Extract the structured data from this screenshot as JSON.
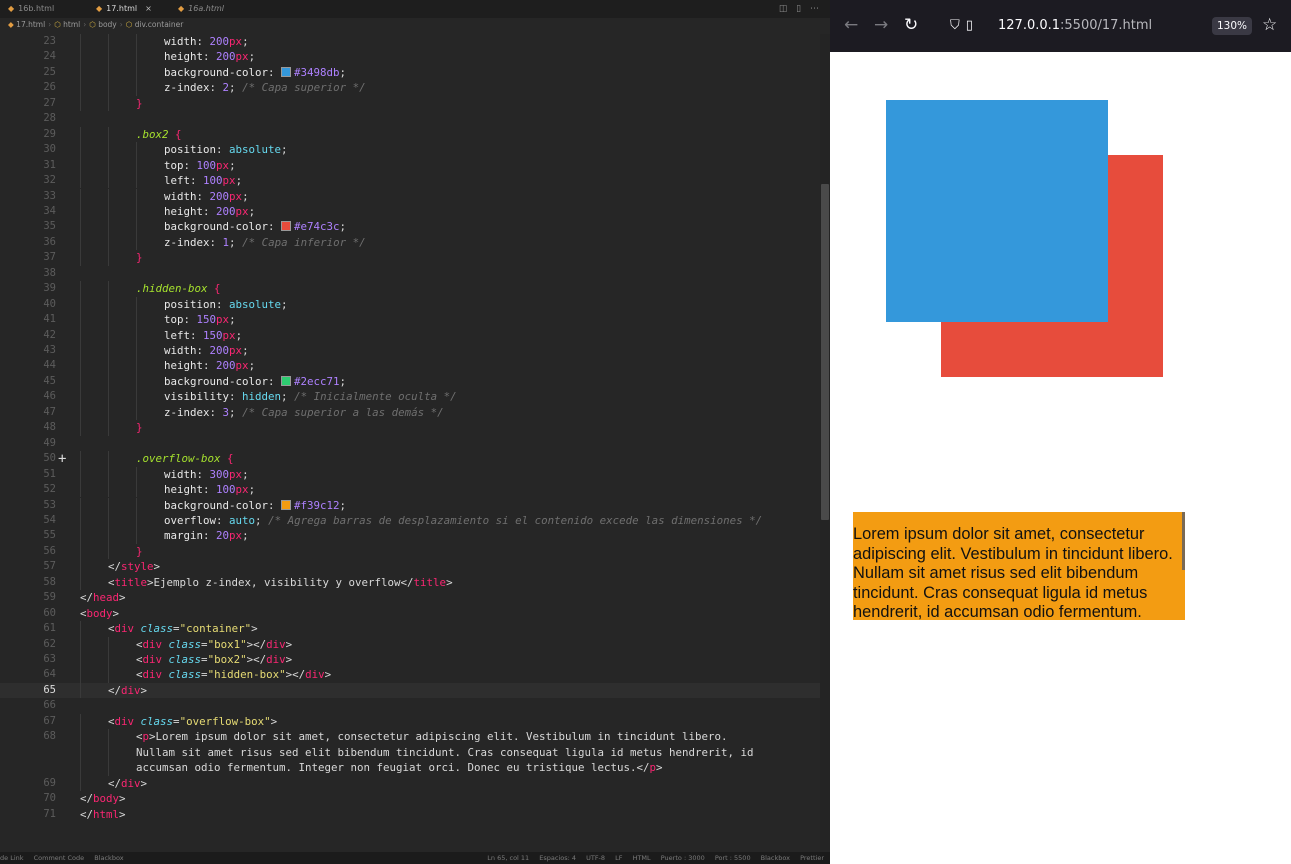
{
  "editor": {
    "tabs": [
      {
        "label": "16b.html",
        "state": "normal"
      },
      {
        "label": "17.html",
        "state": "active"
      },
      {
        "label": "16a.html",
        "state": "preview"
      }
    ],
    "tab_close_glyph": "×",
    "breadcrumb": [
      "17.html",
      "html",
      "body",
      "div.container"
    ],
    "current_line": 65,
    "lines": [
      {
        "n": "23",
        "segs": [
          [
            "prop",
            "width"
          ],
          [
            "pun",
            ": "
          ],
          [
            "num",
            "200"
          ],
          [
            "unit",
            "px"
          ],
          [
            "pun",
            ";"
          ]
        ],
        "indent": 3
      },
      {
        "n": "24",
        "segs": [
          [
            "prop",
            "height"
          ],
          [
            "pun",
            ": "
          ],
          [
            "num",
            "200"
          ],
          [
            "unit",
            "px"
          ],
          [
            "pun",
            ";"
          ]
        ],
        "indent": 3
      },
      {
        "n": "25",
        "segs": [
          [
            "prop",
            "background-color"
          ],
          [
            "pun",
            ": "
          ],
          [
            "swatch",
            "#3498db"
          ],
          [
            "num",
            "#3498db"
          ],
          [
            "pun",
            ";"
          ]
        ],
        "indent": 3
      },
      {
        "n": "26",
        "segs": [
          [
            "prop",
            "z-index"
          ],
          [
            "pun",
            ": "
          ],
          [
            "num",
            "2"
          ],
          [
            "pun",
            "; "
          ],
          [
            "cmt",
            "/* Capa superior */"
          ]
        ],
        "indent": 3
      },
      {
        "n": "27",
        "segs": [
          [
            "brc",
            "}"
          ]
        ],
        "indent": 2
      },
      {
        "n": "28",
        "segs": [],
        "indent": 0
      },
      {
        "n": "29",
        "segs": [
          [
            "sel",
            ".box2 "
          ],
          [
            "brc",
            "{"
          ]
        ],
        "indent": 2
      },
      {
        "n": "30",
        "segs": [
          [
            "prop",
            "position"
          ],
          [
            "pun",
            ": "
          ],
          [
            "val",
            "absolute"
          ],
          [
            "pun",
            ";"
          ]
        ],
        "indent": 3
      },
      {
        "n": "31",
        "segs": [
          [
            "prop",
            "top"
          ],
          [
            "pun",
            ": "
          ],
          [
            "num",
            "100"
          ],
          [
            "unit",
            "px"
          ],
          [
            "pun",
            ";"
          ]
        ],
        "indent": 3
      },
      {
        "n": "32",
        "segs": [
          [
            "prop",
            "left"
          ],
          [
            "pun",
            ": "
          ],
          [
            "num",
            "100"
          ],
          [
            "unit",
            "px"
          ],
          [
            "pun",
            ";"
          ]
        ],
        "indent": 3
      },
      {
        "n": "33",
        "segs": [
          [
            "prop",
            "width"
          ],
          [
            "pun",
            ": "
          ],
          [
            "num",
            "200"
          ],
          [
            "unit",
            "px"
          ],
          [
            "pun",
            ";"
          ]
        ],
        "indent": 3
      },
      {
        "n": "34",
        "segs": [
          [
            "prop",
            "height"
          ],
          [
            "pun",
            ": "
          ],
          [
            "num",
            "200"
          ],
          [
            "unit",
            "px"
          ],
          [
            "pun",
            ";"
          ]
        ],
        "indent": 3
      },
      {
        "n": "35",
        "segs": [
          [
            "prop",
            "background-color"
          ],
          [
            "pun",
            ": "
          ],
          [
            "swatch",
            "#e74c3c"
          ],
          [
            "num",
            "#e74c3c"
          ],
          [
            "pun",
            ";"
          ]
        ],
        "indent": 3
      },
      {
        "n": "36",
        "segs": [
          [
            "prop",
            "z-index"
          ],
          [
            "pun",
            ": "
          ],
          [
            "num",
            "1"
          ],
          [
            "pun",
            "; "
          ],
          [
            "cmt",
            "/* Capa inferior */"
          ]
        ],
        "indent": 3
      },
      {
        "n": "37",
        "segs": [
          [
            "brc",
            "}"
          ]
        ],
        "indent": 2
      },
      {
        "n": "38",
        "segs": [],
        "indent": 0
      },
      {
        "n": "39",
        "segs": [
          [
            "sel",
            ".hidden-box "
          ],
          [
            "brc",
            "{"
          ]
        ],
        "indent": 2
      },
      {
        "n": "40",
        "segs": [
          [
            "prop",
            "position"
          ],
          [
            "pun",
            ": "
          ],
          [
            "val",
            "absolute"
          ],
          [
            "pun",
            ";"
          ]
        ],
        "indent": 3
      },
      {
        "n": "41",
        "segs": [
          [
            "prop",
            "top"
          ],
          [
            "pun",
            ": "
          ],
          [
            "num",
            "150"
          ],
          [
            "unit",
            "px"
          ],
          [
            "pun",
            ";"
          ]
        ],
        "indent": 3
      },
      {
        "n": "42",
        "segs": [
          [
            "prop",
            "left"
          ],
          [
            "pun",
            ": "
          ],
          [
            "num",
            "150"
          ],
          [
            "unit",
            "px"
          ],
          [
            "pun",
            ";"
          ]
        ],
        "indent": 3
      },
      {
        "n": "43",
        "segs": [
          [
            "prop",
            "width"
          ],
          [
            "pun",
            ": "
          ],
          [
            "num",
            "200"
          ],
          [
            "unit",
            "px"
          ],
          [
            "pun",
            ";"
          ]
        ],
        "indent": 3
      },
      {
        "n": "44",
        "segs": [
          [
            "prop",
            "height"
          ],
          [
            "pun",
            ": "
          ],
          [
            "num",
            "200"
          ],
          [
            "unit",
            "px"
          ],
          [
            "pun",
            ";"
          ]
        ],
        "indent": 3
      },
      {
        "n": "45",
        "segs": [
          [
            "prop",
            "background-color"
          ],
          [
            "pun",
            ": "
          ],
          [
            "swatch",
            "#2ecc71"
          ],
          [
            "num",
            "#2ecc71"
          ],
          [
            "pun",
            ";"
          ]
        ],
        "indent": 3
      },
      {
        "n": "46",
        "segs": [
          [
            "prop",
            "visibility"
          ],
          [
            "pun",
            ": "
          ],
          [
            "val",
            "hidden"
          ],
          [
            "pun",
            "; "
          ],
          [
            "cmt",
            "/* Inicialmente oculta */"
          ]
        ],
        "indent": 3
      },
      {
        "n": "47",
        "segs": [
          [
            "prop",
            "z-index"
          ],
          [
            "pun",
            ": "
          ],
          [
            "num",
            "3"
          ],
          [
            "pun",
            "; "
          ],
          [
            "cmt",
            "/* Capa superior a las demás */"
          ]
        ],
        "indent": 3
      },
      {
        "n": "48",
        "segs": [
          [
            "brc",
            "}"
          ]
        ],
        "indent": 2
      },
      {
        "n": "49",
        "segs": [],
        "indent": 0
      },
      {
        "n": "50",
        "segs": [
          [
            "sel",
            ".overflow-box "
          ],
          [
            "brc",
            "{"
          ]
        ],
        "indent": 2
      },
      {
        "n": "51",
        "segs": [
          [
            "prop",
            "width"
          ],
          [
            "pun",
            ": "
          ],
          [
            "num",
            "300"
          ],
          [
            "unit",
            "px"
          ],
          [
            "pun",
            ";"
          ]
        ],
        "indent": 3
      },
      {
        "n": "52",
        "segs": [
          [
            "prop",
            "height"
          ],
          [
            "pun",
            ": "
          ],
          [
            "num",
            "100"
          ],
          [
            "unit",
            "px"
          ],
          [
            "pun",
            ";"
          ]
        ],
        "indent": 3
      },
      {
        "n": "53",
        "segs": [
          [
            "prop",
            "background-color"
          ],
          [
            "pun",
            ": "
          ],
          [
            "swatch",
            "#f39c12"
          ],
          [
            "num",
            "#f39c12"
          ],
          [
            "pun",
            ";"
          ]
        ],
        "indent": 3
      },
      {
        "n": "54",
        "segs": [
          [
            "prop",
            "overflow"
          ],
          [
            "pun",
            ": "
          ],
          [
            "val",
            "auto"
          ],
          [
            "pun",
            "; "
          ],
          [
            "cmt",
            "/* Agrega barras de desplazamiento si el contenido excede las dimensiones */"
          ]
        ],
        "indent": 3
      },
      {
        "n": "55",
        "segs": [
          [
            "prop",
            "margin"
          ],
          [
            "pun",
            ": "
          ],
          [
            "num",
            "20"
          ],
          [
            "unit",
            "px"
          ],
          [
            "pun",
            ";"
          ]
        ],
        "indent": 3
      },
      {
        "n": "56",
        "segs": [
          [
            "brc",
            "}"
          ]
        ],
        "indent": 2
      },
      {
        "n": "57",
        "segs": [
          [
            "pun",
            "</"
          ],
          [
            "tag",
            "style"
          ],
          [
            "pun",
            ">"
          ]
        ],
        "indent": 1
      },
      {
        "n": "58",
        "segs": [
          [
            "pun",
            "<"
          ],
          [
            "tag",
            "title"
          ],
          [
            "pun",
            ">Ejemplo z-index, visibility y overflow</"
          ],
          [
            "tag",
            "title"
          ],
          [
            "pun",
            ">"
          ]
        ],
        "indent": 1
      },
      {
        "n": "59",
        "segs": [
          [
            "pun",
            "</"
          ],
          [
            "tag",
            "head"
          ],
          [
            "pun",
            ">"
          ]
        ],
        "indent": 0
      },
      {
        "n": "60",
        "segs": [
          [
            "pun",
            "<"
          ],
          [
            "tag",
            "body"
          ],
          [
            "pun",
            ">"
          ]
        ],
        "indent": 0
      },
      {
        "n": "61",
        "segs": [
          [
            "pun",
            "<"
          ],
          [
            "tag",
            "div "
          ],
          [
            "attr",
            "class"
          ],
          [
            "pun",
            "="
          ],
          [
            "str",
            "\"container\""
          ],
          [
            "pun",
            ">"
          ]
        ],
        "indent": 1
      },
      {
        "n": "62",
        "segs": [
          [
            "pun",
            "<"
          ],
          [
            "tag",
            "div "
          ],
          [
            "attr",
            "class"
          ],
          [
            "pun",
            "="
          ],
          [
            "str",
            "\"box1\""
          ],
          [
            "pun",
            "></"
          ],
          [
            "tag",
            "div"
          ],
          [
            "pun",
            ">"
          ]
        ],
        "indent": 2
      },
      {
        "n": "63",
        "segs": [
          [
            "pun",
            "<"
          ],
          [
            "tag",
            "div "
          ],
          [
            "attr",
            "class"
          ],
          [
            "pun",
            "="
          ],
          [
            "str",
            "\"box2\""
          ],
          [
            "pun",
            "></"
          ],
          [
            "tag",
            "div"
          ],
          [
            "pun",
            ">"
          ]
        ],
        "indent": 2
      },
      {
        "n": "64",
        "segs": [
          [
            "pun",
            "<"
          ],
          [
            "tag",
            "div "
          ],
          [
            "attr",
            "class"
          ],
          [
            "pun",
            "="
          ],
          [
            "str",
            "\"hidden-box\""
          ],
          [
            "pun",
            "></"
          ],
          [
            "tag",
            "div"
          ],
          [
            "pun",
            ">"
          ]
        ],
        "indent": 2
      },
      {
        "n": "65",
        "segs": [
          [
            "pun",
            "</"
          ],
          [
            "tag",
            "div"
          ],
          [
            "pun",
            ">"
          ]
        ],
        "indent": 1
      },
      {
        "n": "66",
        "segs": [],
        "indent": 0
      },
      {
        "n": "67",
        "segs": [
          [
            "pun",
            "<"
          ],
          [
            "tag",
            "div "
          ],
          [
            "attr",
            "class"
          ],
          [
            "pun",
            "="
          ],
          [
            "str",
            "\"overflow-box\""
          ],
          [
            "pun",
            ">"
          ]
        ],
        "indent": 1
      },
      {
        "n": "68",
        "segs": [
          [
            "pun",
            "<"
          ],
          [
            "tag",
            "p"
          ],
          [
            "pun",
            ">Lorem ipsum dolor sit amet, consectetur adipiscing elit. Vestibulum in tincidunt libero."
          ]
        ],
        "indent": 2
      },
      {
        "n": "",
        "segs": [
          [
            "pun",
            "Nullam sit amet risus sed elit bibendum tincidunt. Cras consequat ligula id metus hendrerit, id"
          ]
        ],
        "indent": 2
      },
      {
        "n": "",
        "segs": [
          [
            "pun",
            "accumsan odio fermentum. Integer non feugiat orci. Donec eu tristique lectus.</"
          ],
          [
            "tag",
            "p"
          ],
          [
            "pun",
            ">"
          ]
        ],
        "indent": 2
      },
      {
        "n": "69",
        "segs": [
          [
            "pun",
            "</"
          ],
          [
            "tag",
            "div"
          ],
          [
            "pun",
            ">"
          ]
        ],
        "indent": 1
      },
      {
        "n": "70",
        "segs": [
          [
            "pun",
            "</"
          ],
          [
            "tag",
            "body"
          ],
          [
            "pun",
            ">"
          ]
        ],
        "indent": 0
      },
      {
        "n": "71",
        "segs": [
          [
            "pun",
            "</"
          ],
          [
            "tag",
            "html"
          ],
          [
            "pun",
            ">"
          ]
        ],
        "indent": 0
      }
    ],
    "statusbar": {
      "left": [
        "de Link",
        "Comment Code",
        "Blackbox"
      ],
      "right": [
        "Ln 65, col 11",
        "Espacios: 4",
        "UTF-8",
        "LF",
        "HTML",
        "Puerto : 3000",
        "Port : 5500",
        "Blackbox",
        "Prettier"
      ]
    }
  },
  "browser": {
    "url_host": "127.0.0.1",
    "url_path": ":5500/17.html",
    "zoom": "130%",
    "icons": {
      "back": "arrow-left-icon",
      "forward": "arrow-right-icon",
      "reload": "reload-icon",
      "shield": "shield-icon",
      "page": "page-icon",
      "bookmark": "star-icon"
    },
    "page": {
      "box1_color": "#3498db",
      "box2_color": "#e74c3c",
      "overflow_color": "#f39c12",
      "overflow_text": "Lorem ipsum dolor sit amet, consectetur adipiscing elit. Vestibulum in tincidunt libero. Nullam sit amet risus sed elit bibendum tincidunt. Cras consequat ligula id metus hendrerit, id accumsan odio fermentum. Integer non feugiat orci. Donec eu tristique lectus."
    }
  }
}
